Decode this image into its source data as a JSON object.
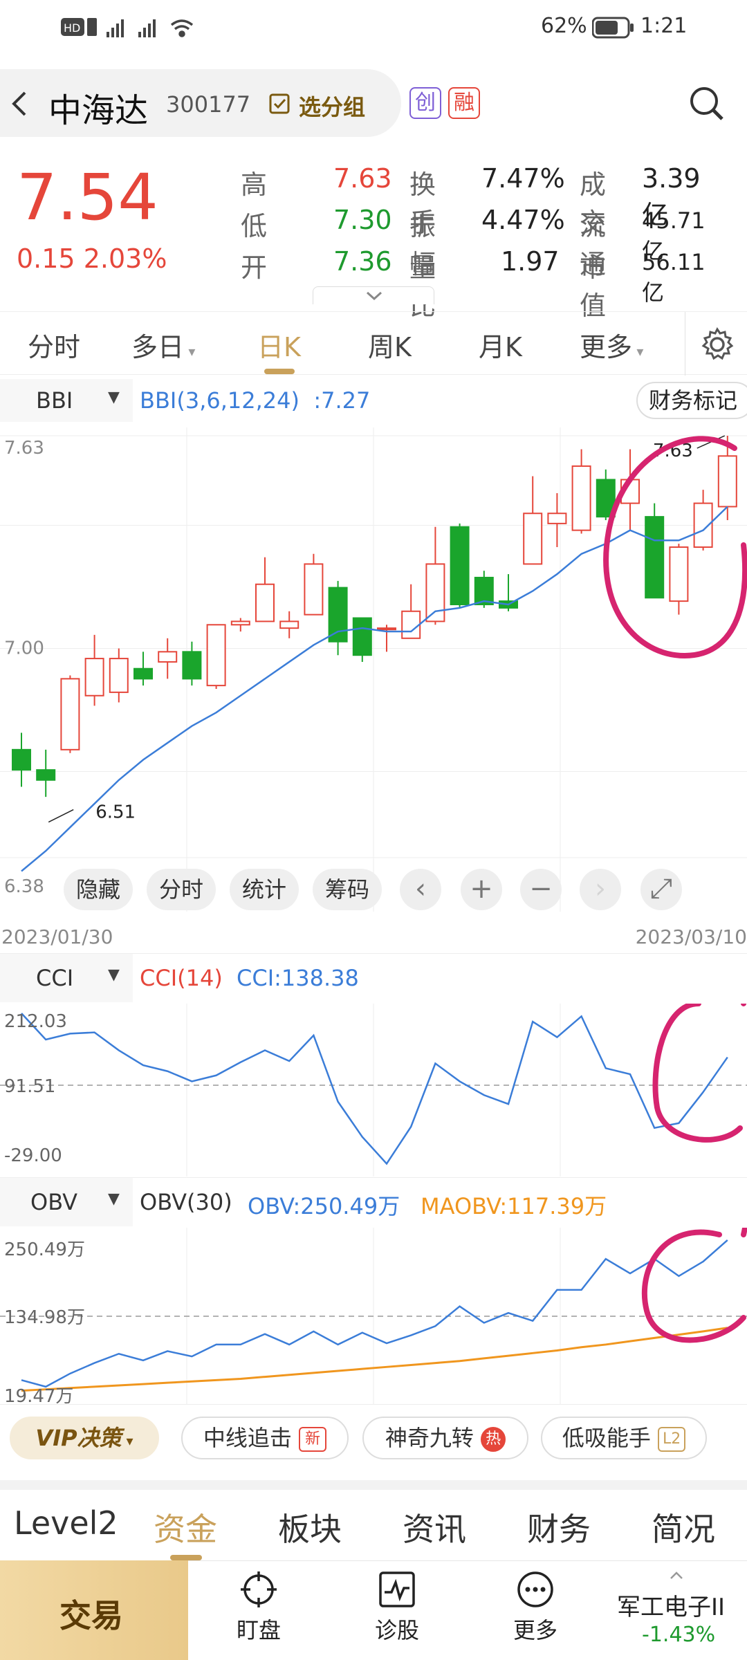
{
  "status": {
    "left_icons": [
      "hd-icon",
      "sim-icon",
      "5g-signal-icon",
      "4g-signal-icon",
      "wifi-icon"
    ],
    "battery_pct": "62%",
    "time": "1:21"
  },
  "header": {
    "name": "中海达",
    "code": "300177",
    "group_label": "选分组",
    "tag_chuang": "创",
    "tag_rong": "融"
  },
  "quote": {
    "price": "7.54",
    "change": "0.15",
    "change_pct": "2.03%",
    "rows": [
      {
        "l1": "高",
        "v1": "7.63",
        "l2": "换手",
        "v2": "7.47%",
        "l3": "成交",
        "v3": "3.39亿"
      },
      {
        "l1": "低",
        "v1": "7.30",
        "l2": "振幅",
        "v2": "4.47%",
        "l3": "流通",
        "v3": "45.71亿"
      },
      {
        "l1": "开",
        "v1": "7.36",
        "l2": "量比",
        "v2": "1.97",
        "l3": "市值",
        "v3": "56.11亿"
      }
    ]
  },
  "tabs": [
    "分时",
    "多日",
    "日K",
    "周K",
    "月K",
    "更多"
  ],
  "kline": {
    "selector": "BBI",
    "legend": "BBI(3,6,12,24)  :7.27",
    "finance_btn": "财务标记",
    "y_top": "7.63",
    "y_mid": "7.00",
    "y_bot": "6.38",
    "hi_mark": "7.63",
    "lo_mark": "6.51",
    "date_start": "2023/01/30",
    "date_end": "2023/03/10",
    "buttons": [
      "隐藏",
      "分时",
      "统计",
      "筹码"
    ],
    "candles": [
      [
        6.7,
        6.64,
        6.75,
        6.59
      ],
      [
        6.64,
        6.61,
        6.7,
        6.56
      ],
      [
        6.7,
        6.91,
        6.92,
        6.69
      ],
      [
        6.86,
        6.97,
        7.04,
        6.83
      ],
      [
        6.87,
        6.97,
        7.0,
        6.84
      ],
      [
        6.94,
        6.91,
        6.99,
        6.89
      ],
      [
        6.96,
        6.99,
        7.03,
        6.91
      ],
      [
        6.99,
        6.91,
        7.02,
        6.89
      ],
      [
        6.89,
        7.07,
        7.07,
        6.88
      ],
      [
        7.07,
        7.08,
        7.09,
        7.05
      ],
      [
        7.08,
        7.19,
        7.27,
        7.08
      ],
      [
        7.06,
        7.08,
        7.11,
        7.03
      ],
      [
        7.1,
        7.25,
        7.28,
        7.1
      ],
      [
        7.18,
        7.02,
        7.2,
        6.98
      ],
      [
        7.09,
        6.98,
        7.09,
        6.96
      ],
      [
        7.06,
        7.06,
        7.07,
        6.99
      ],
      [
        7.03,
        7.11,
        7.19,
        7.03
      ],
      [
        7.08,
        7.25,
        7.36,
        7.07
      ],
      [
        7.36,
        7.13,
        7.37,
        7.12
      ],
      [
        7.21,
        7.13,
        7.23,
        7.12
      ],
      [
        7.14,
        7.12,
        7.22,
        7.11
      ],
      [
        7.25,
        7.4,
        7.51,
        7.25
      ],
      [
        7.37,
        7.4,
        7.46,
        7.3
      ],
      [
        7.35,
        7.54,
        7.59,
        7.34
      ],
      [
        7.5,
        7.39,
        7.53,
        7.38
      ],
      [
        7.43,
        7.5,
        7.59,
        7.35
      ],
      [
        7.39,
        7.15,
        7.43,
        7.15
      ],
      [
        7.14,
        7.3,
        7.31,
        7.1
      ],
      [
        7.3,
        7.43,
        7.47,
        7.29
      ],
      [
        7.42,
        7.57,
        7.63,
        7.38
      ]
    ],
    "bbi": [
      6.34,
      6.4,
      6.47,
      6.54,
      6.61,
      6.67,
      6.72,
      6.77,
      6.81,
      6.86,
      6.91,
      6.96,
      7.01,
      7.05,
      7.06,
      7.05,
      7.05,
      7.11,
      7.12,
      7.14,
      7.13,
      7.17,
      7.22,
      7.28,
      7.31,
      7.35,
      7.32,
      7.32,
      7.35,
      7.42
    ]
  },
  "cci": {
    "selector": "CCI",
    "legend1": "CCI(14)",
    "legend2": "CCI:138.38",
    "y_top": "212.03",
    "y_mid": "91.51",
    "y_bot": "-29.00",
    "values": [
      212.0,
      168.0,
      178.0,
      180.0,
      150.0,
      125.0,
      115.0,
      98.0,
      108.0,
      130.0,
      150.0,
      132.0,
      175.0,
      64.0,
      5.0,
      -40.0,
      22.0,
      128.0,
      98.0,
      75.0,
      60.0,
      198.0,
      172.0,
      207.0,
      120.0,
      110.0,
      20.0,
      28.0,
      80.0,
      138.4
    ]
  },
  "obv": {
    "selector": "OBV",
    "legend1": "OBV(30)",
    "legend2": "OBV:250.49万",
    "legend3": "MAOBV:117.39万",
    "y_top": "250.49万",
    "y_mid": "134.98万",
    "y_bot": "19.47万",
    "values": [
      38,
      28,
      48,
      64,
      78,
      68,
      82,
      74,
      92,
      92,
      108,
      92,
      112,
      92,
      110,
      94,
      106,
      120,
      150,
      125,
      140,
      128,
      175,
      175,
      222,
      200,
      222,
      196,
      218,
      250.5
    ],
    "maobv": [
      22,
      24,
      26,
      28,
      30,
      32,
      34,
      36,
      38,
      40,
      43,
      46,
      49,
      52,
      55,
      58,
      61,
      64,
      67,
      71,
      75,
      79,
      83,
      88,
      92,
      97,
      102,
      107,
      112,
      117.4
    ]
  },
  "features": {
    "vip": "VIP决策",
    "items": [
      "中线追击",
      "神奇九转",
      "低吸能手"
    ],
    "badge_new": "新",
    "badge_hot": "热",
    "badge_l2": "L2"
  },
  "bottom_tabs": [
    "Level2",
    "资金",
    "板块",
    "资讯",
    "财务",
    "简况"
  ],
  "bottom_nav": {
    "trade": "交易",
    "items": [
      "盯盘",
      "诊股",
      "更多"
    ],
    "sector_name": "军工电子II",
    "sector_change": "-1.43%"
  },
  "colors": {
    "up": "#e5463a",
    "down": "#1aa52c",
    "bbi": "#3b7dd8",
    "maobv": "#f0961e",
    "accent": "#c9a15b",
    "marker": "#d6246f"
  }
}
